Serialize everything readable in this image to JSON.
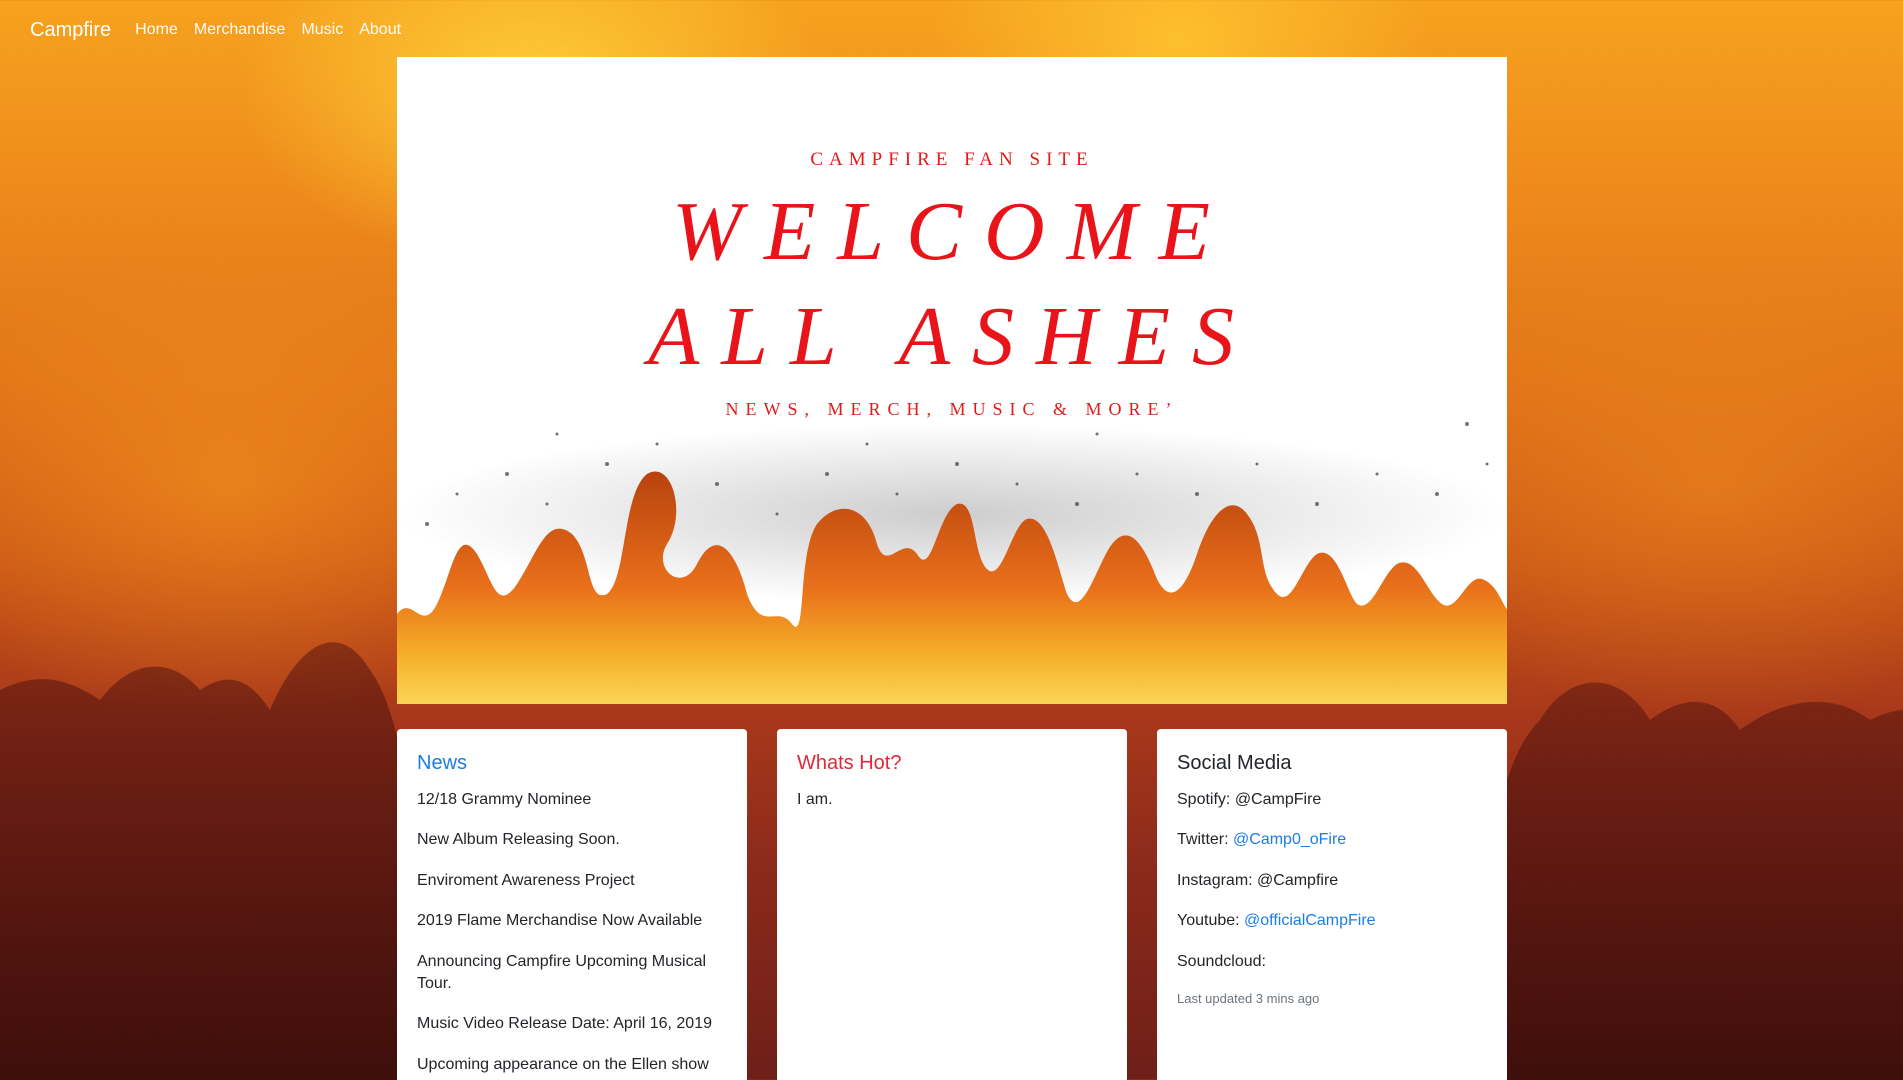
{
  "nav": {
    "brand": "Campfire",
    "links": [
      "Home",
      "Merchandise",
      "Music",
      "About"
    ]
  },
  "hero": {
    "kicker": "CAMPFIRE FAN SITE",
    "title_line1": "WELCOME",
    "title_line2": "ALL ASHES",
    "tagline": "NEWS, MERCH, MUSIC & MORE’"
  },
  "news": {
    "title": "News",
    "items": [
      "12/18 Grammy Nominee",
      "New Album Releasing Soon.",
      "Enviroment Awareness Project",
      "2019 Flame Merchandise Now Available",
      "Announcing Campfire Upcoming Musical Tour.",
      "Music Video Release Date: April 16, 2019",
      "Upcoming appearance on the Ellen show"
    ]
  },
  "hot": {
    "title": "Whats Hot?",
    "text": "I am."
  },
  "social": {
    "title": "Social Media",
    "spotify_label": "Spotify: ",
    "spotify_value": "@CampFire",
    "twitter_label": "Twitter: ",
    "twitter_value": "@Camp0_oFire",
    "instagram_label": "Instagram: ",
    "instagram_value": "@Campfire",
    "youtube_label": "Youtube: ",
    "youtube_value": "@officialCampFire",
    "soundcloud_label": "Soundcloud:",
    "updated": "Last updated 3 mins ago"
  },
  "colors": {
    "accent_blue": "#1a7ee6",
    "accent_red": "#e2283a",
    "hero_red": "#e8141a"
  }
}
